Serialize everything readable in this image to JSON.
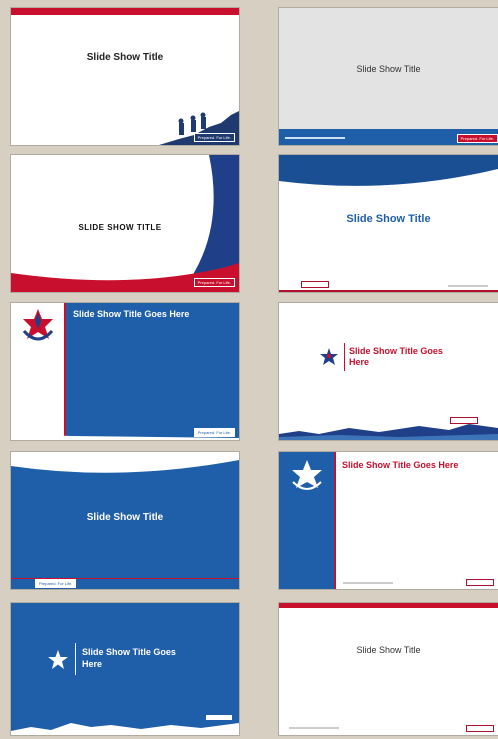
{
  "colors": {
    "background": "#d7d0c2",
    "bsa_blue": "#1f5ea8",
    "bsa_dark_blue": "#1a4f93",
    "bsa_red": "#c8102e"
  },
  "templates": [
    {
      "id": 1,
      "title": "Slide Show Title",
      "badge": "Prepared. For Life."
    },
    {
      "id": 2,
      "title": "Slide Show Title",
      "badge": "Prepared. For Life."
    },
    {
      "id": 3,
      "title": "SLIDE SHOW TITLE",
      "badge": "Prepared. For Life."
    },
    {
      "id": 4,
      "title": "Slide Show Title"
    },
    {
      "id": 5,
      "title": "Slide Show Title Goes Here",
      "badge": "Prepared. For Life."
    },
    {
      "id": 6,
      "title": "Slide Show Title Goes Here"
    },
    {
      "id": 7,
      "title": "Slide Show Title",
      "badge": "Prepared. For Life."
    },
    {
      "id": 8,
      "title": "Slide Show Title Goes Here"
    },
    {
      "id": 9,
      "title": "Slide Show Title Goes Here"
    },
    {
      "id": 10,
      "title": "Slide Show Title"
    }
  ]
}
